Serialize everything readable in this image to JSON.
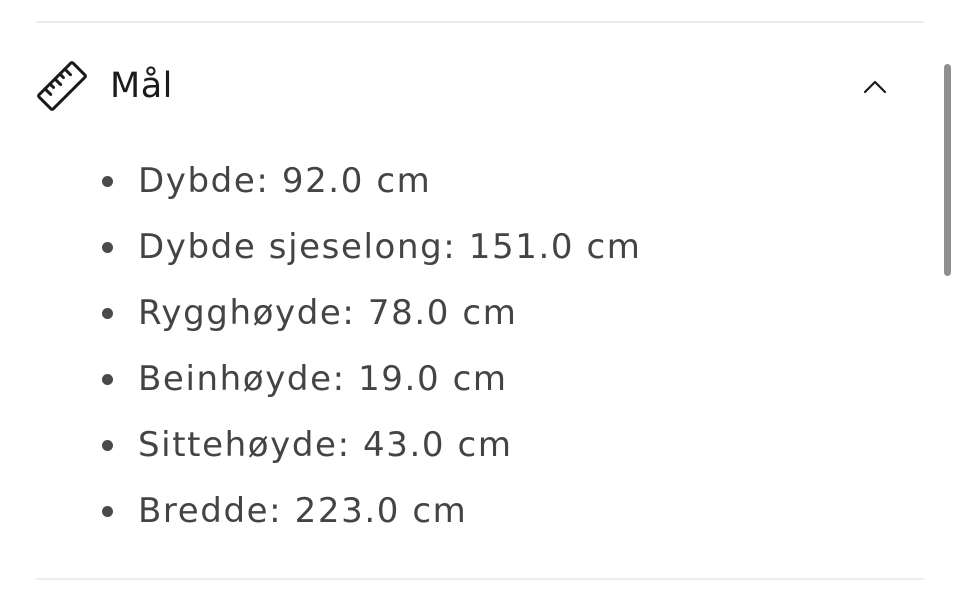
{
  "section": {
    "title": "Mål",
    "icon": "ruler-icon",
    "toggle_icon": "chevron-up-icon",
    "expanded": true
  },
  "dimensions": [
    "Dybde: 92.0 cm",
    "Dybde sjeselong: 151.0 cm",
    "Rygghøyde: 78.0 cm",
    "Beinhøyde: 19.0 cm",
    "Sittehøyde: 43.0 cm",
    "Bredde: 223.0 cm"
  ],
  "colors": {
    "text": "#444444",
    "title": "#1b1b1b",
    "divider": "#ececec",
    "scrollbar": "#8f8f8f"
  }
}
